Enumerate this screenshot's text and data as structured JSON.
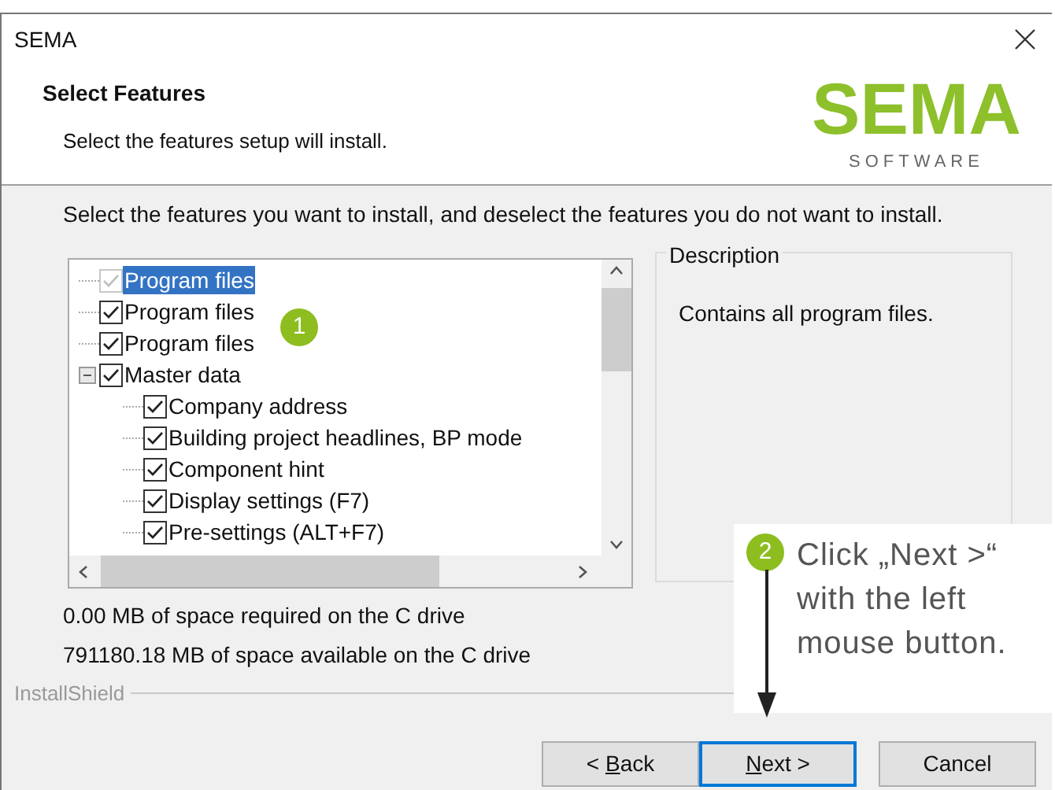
{
  "window": {
    "title": "SEMA"
  },
  "header": {
    "title": "Select Features",
    "subtitle": "Select the features setup will install."
  },
  "logo": {
    "wordmark": "SEMA",
    "tagline": "SOFTWARE"
  },
  "instruction": "Select the features you want to install, and deselect the features you do not want to install.",
  "tree": [
    {
      "label": "Program files",
      "checked": true,
      "disabled": true,
      "selected": true
    },
    {
      "label": "Program files",
      "checked": true,
      "disabled": false,
      "selected": false
    },
    {
      "label": "Program files",
      "checked": true,
      "disabled": false,
      "selected": false
    },
    {
      "label": "Master data",
      "checked": true,
      "disabled": false,
      "selected": false,
      "expanded": true,
      "children": [
        {
          "label": "Company address",
          "checked": true,
          "disabled": false,
          "selected": false
        },
        {
          "label": "Building project headlines, BP mode",
          "checked": true,
          "disabled": false,
          "selected": false
        },
        {
          "label": "Component hint",
          "checked": true,
          "disabled": false,
          "selected": false
        },
        {
          "label": "Display settings (F7)",
          "checked": true,
          "disabled": false,
          "selected": false
        },
        {
          "label": "Pre-settings (ALT+F7)",
          "checked": true,
          "disabled": false,
          "selected": false
        }
      ]
    }
  ],
  "description": {
    "legend": "Description",
    "text": "Contains all program files."
  },
  "space": [
    "0.00 MB of space required on the C drive",
    "791180.18 MB of space available on the C drive"
  ],
  "brand": "InstallShield",
  "buttons": [
    {
      "before": "< ",
      "mnemonic": "B",
      "after": "ack",
      "focused": false
    },
    {
      "mnemonic": "N",
      "after": "ext >",
      "focused": true
    },
    {
      "after": "Cancel",
      "focused": false
    }
  ],
  "callouts": [
    {
      "number": "1"
    },
    {
      "number": "2",
      "text": "Click „Next >“ with the left mouse button."
    }
  ]
}
